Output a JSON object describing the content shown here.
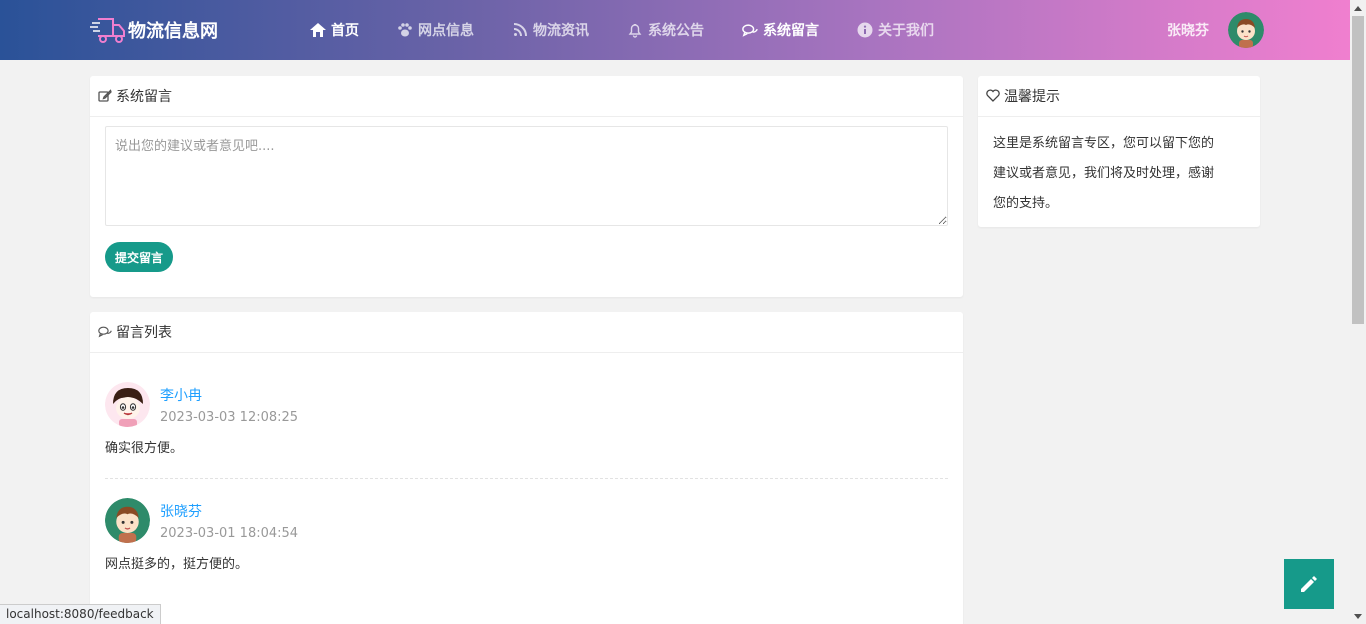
{
  "brand": {
    "name": "物流信息网"
  },
  "nav": {
    "items": [
      {
        "label": "首页",
        "icon": "home-icon"
      },
      {
        "label": "网点信息",
        "icon": "paw-icon"
      },
      {
        "label": "物流资讯",
        "icon": "rss-icon"
      },
      {
        "label": "系统公告",
        "icon": "bell-icon"
      },
      {
        "label": "系统留言",
        "icon": "comments-icon",
        "active": true
      },
      {
        "label": "关于我们",
        "icon": "info-icon"
      }
    ]
  },
  "user": {
    "name": "张晓芬"
  },
  "feedback_form": {
    "title": "系统留言",
    "placeholder": "说出您的建议或者意见吧....",
    "submit_label": "提交留言"
  },
  "messages": {
    "title": "留言列表",
    "items": [
      {
        "name": "李小冉",
        "time": "2023-03-03 12:08:25",
        "text": "确实很方便。"
      },
      {
        "name": "张晓芬",
        "time": "2023-03-01 18:04:54",
        "text": "网点挺多的，挺方便的。"
      }
    ]
  },
  "tips": {
    "title": "温馨提示",
    "lines": [
      "这里是系统留言专区，您可以留下您的",
      "建议或者意见，我们将及时处理，感谢",
      "您的支持。"
    ]
  },
  "status_bar": {
    "url": "localhost:8080/feedback"
  },
  "colors": {
    "accent": "#169a8a",
    "link": "#1e9fff"
  }
}
